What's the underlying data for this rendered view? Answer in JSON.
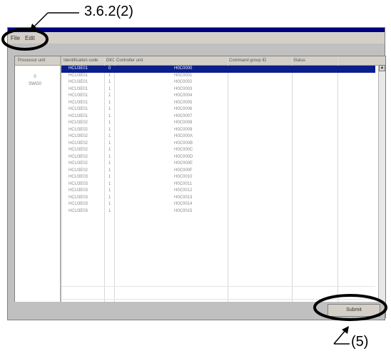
{
  "annotations": {
    "top_label": "3.6.2(2)",
    "bottom_label": "(5)"
  },
  "menubar": {
    "items": [
      "File",
      "Edit"
    ]
  },
  "grid": {
    "columns": [
      "Processor unit",
      "Identification code",
      "DKC",
      "Controller unit",
      "Command group ID",
      "Status"
    ],
    "left_items": [
      "0",
      "SWG0"
    ],
    "rows": [
      {
        "a": "HCU3E01",
        "b": "0",
        "c": "H0C0000",
        "selected": true
      },
      {
        "a": "HCU3E01",
        "b": "1",
        "c": "H0C0001"
      },
      {
        "a": "HCU3E01",
        "b": "1",
        "c": "H0C0002"
      },
      {
        "a": "HCU3E01",
        "b": "1",
        "c": "H0C0003"
      },
      {
        "a": "HCU3E01",
        "b": "1",
        "c": "H0C0004"
      },
      {
        "a": "HCU3E01",
        "b": "1",
        "c": "H0C0005"
      },
      {
        "a": "HCU3E01",
        "b": "1",
        "c": "H0C0006"
      },
      {
        "a": "HCU3E01",
        "b": "1",
        "c": "H0C0007"
      },
      {
        "a": "HCU3E02",
        "b": "1",
        "c": "H0C0008"
      },
      {
        "a": "HCU3E02",
        "b": "1",
        "c": "H0C0009"
      },
      {
        "a": "HCU3E02",
        "b": "1",
        "c": "H0C000A"
      },
      {
        "a": "HCU3E02",
        "b": "1",
        "c": "H0C000B"
      },
      {
        "a": "HCU3E02",
        "b": "1",
        "c": "H0C000C"
      },
      {
        "a": "HCU3E02",
        "b": "1",
        "c": "H0C000D"
      },
      {
        "a": "HCU3E02",
        "b": "1",
        "c": "H0C000E"
      },
      {
        "a": "HCU3E02",
        "b": "1",
        "c": "H0C000F"
      },
      {
        "a": "HCU3E03",
        "b": "1",
        "c": "H0C0010"
      },
      {
        "a": "HCU3E03",
        "b": "1",
        "c": "H0C0011"
      },
      {
        "a": "HCU3E03",
        "b": "1",
        "c": "H0C0012"
      },
      {
        "a": "HCU3E03",
        "b": "1",
        "c": "H0C0013"
      },
      {
        "a": "HCU3E03",
        "b": "1",
        "c": "H0C0014"
      },
      {
        "a": "HCU3E03",
        "b": "1",
        "c": "H0C0015"
      }
    ]
  },
  "scrollbar": {
    "up_icon": "arrow-up-icon",
    "down_icon": "arrow-down-icon"
  },
  "footer": {
    "submit_label": "Submit"
  },
  "colors": {
    "selection": "#0a1e8c",
    "titlebar": "#000080",
    "window": "#c0c0c0"
  }
}
